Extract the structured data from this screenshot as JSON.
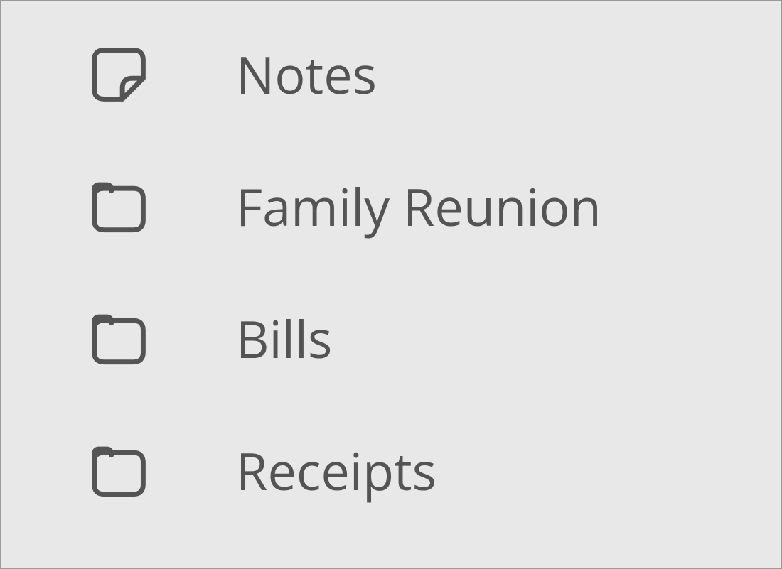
{
  "sidebar": {
    "items": [
      {
        "label": "Notes",
        "icon": "note"
      },
      {
        "label": "Family Reunion",
        "icon": "folder"
      },
      {
        "label": "Bills",
        "icon": "folder"
      },
      {
        "label": "Receipts",
        "icon": "folder"
      }
    ]
  }
}
